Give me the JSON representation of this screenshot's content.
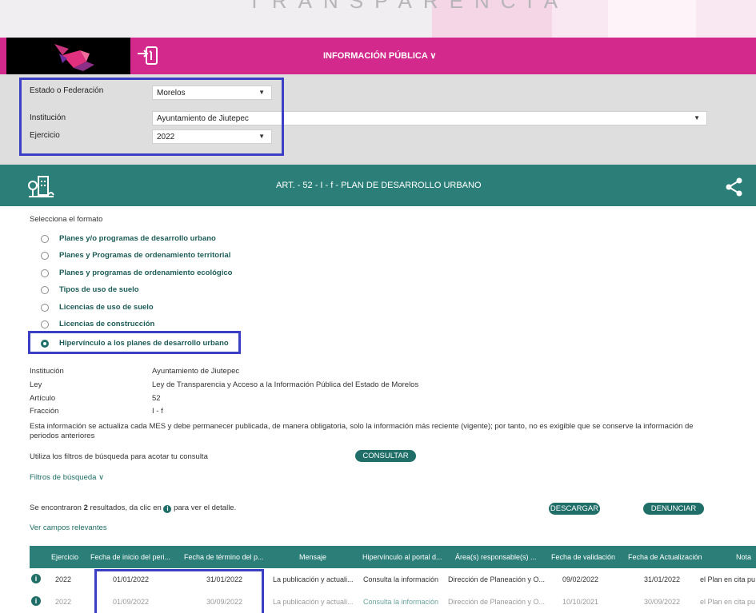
{
  "brand": {
    "partial_text": "TRANSPARENCIA"
  },
  "navbar": {
    "title": "INFORMACIÓN PÚBLICA ∨"
  },
  "filters": {
    "estado_label": "Estado o Federación",
    "estado_value": "Morelos",
    "institucion_label": "Institución",
    "institucion_value": "Ayuntamiento de Jiutepec",
    "ejercicio_label": "Ejercicio",
    "ejercicio_value": "2022"
  },
  "section": {
    "title": "ART. - 52 - I - f - PLAN DE DESARROLLO URBANO"
  },
  "formats": {
    "heading": "Selecciona el formato",
    "options": [
      {
        "label": "Planes y/o programas de desarrollo urbano",
        "selected": false
      },
      {
        "label": "Planes y Programas de ordenamiento territorial",
        "selected": false
      },
      {
        "label": "Planes y programas de ordenamiento ecológico",
        "selected": false
      },
      {
        "label": "Tipos de uso de suelo",
        "selected": false
      },
      {
        "label": "Licencias de uso de suelo",
        "selected": false
      },
      {
        "label": "Licencias de construcción",
        "selected": false
      },
      {
        "label": "Hipervínculo a los planes de desarrollo urbano",
        "selected": true
      }
    ]
  },
  "info": {
    "institucion_label": "Institución",
    "institucion_value": "Ayuntamiento de Jiutepec",
    "ley_label": "Ley",
    "ley_value": "Ley de Transparencia y Acceso a la Información Pública del Estado de Morelos",
    "articulo_label": "Artículo",
    "articulo_value": "52",
    "fraccion_label": "Fracción",
    "fraccion_value": "I - f",
    "note": "Esta información se actualiza cada MES y debe permanecer publicada, de manera obligatoria, solo la información más reciente (vigente); por tanto, no es exigible que se conserve la información de periodos anteriores"
  },
  "search": {
    "hint": "Utiliza los filtros de búsqueda para acotar tu consulta",
    "consultar": "CONSULTAR",
    "filtros": "Filtros de búsqueda ∨"
  },
  "results": {
    "prefix": "Se encontraron ",
    "count": "2",
    "middle": " resultados, da clic en ",
    "suffix": " para ver el detalle.",
    "descargar": "DESCARGAR",
    "denunciar": "DENUNCIAR",
    "ver_campos": "Ver campos relevantes"
  },
  "table": {
    "headers": [
      "Ejercicio",
      "Fecha de inicio del peri...",
      "Fecha de término del p...",
      "Mensaje",
      "Hipervínculo al portal d...",
      "Área(s) responsable(s) ...",
      "Fecha de validación",
      "Fecha de Actualización",
      "Nota"
    ],
    "rows": [
      [
        "2022",
        "01/01/2022",
        "31/01/2022",
        "La publicación y actuali...",
        "Consulta la información",
        "Dirección de Planeación y O...",
        "09/02/2022",
        "31/01/2022",
        "el Plan en cita pu"
      ],
      [
        "2022",
        "01/09/2022",
        "30/09/2022",
        "La publicación y actuali...",
        "Consulta la información",
        "Dirección de Planeación y O...",
        "10/10/2021",
        "30/09/2022",
        "el Plan en cita pu"
      ]
    ]
  },
  "colors": {
    "magenta": "#d3298d",
    "teal": "#2b7f78",
    "highlight": "#3b3fc4"
  }
}
